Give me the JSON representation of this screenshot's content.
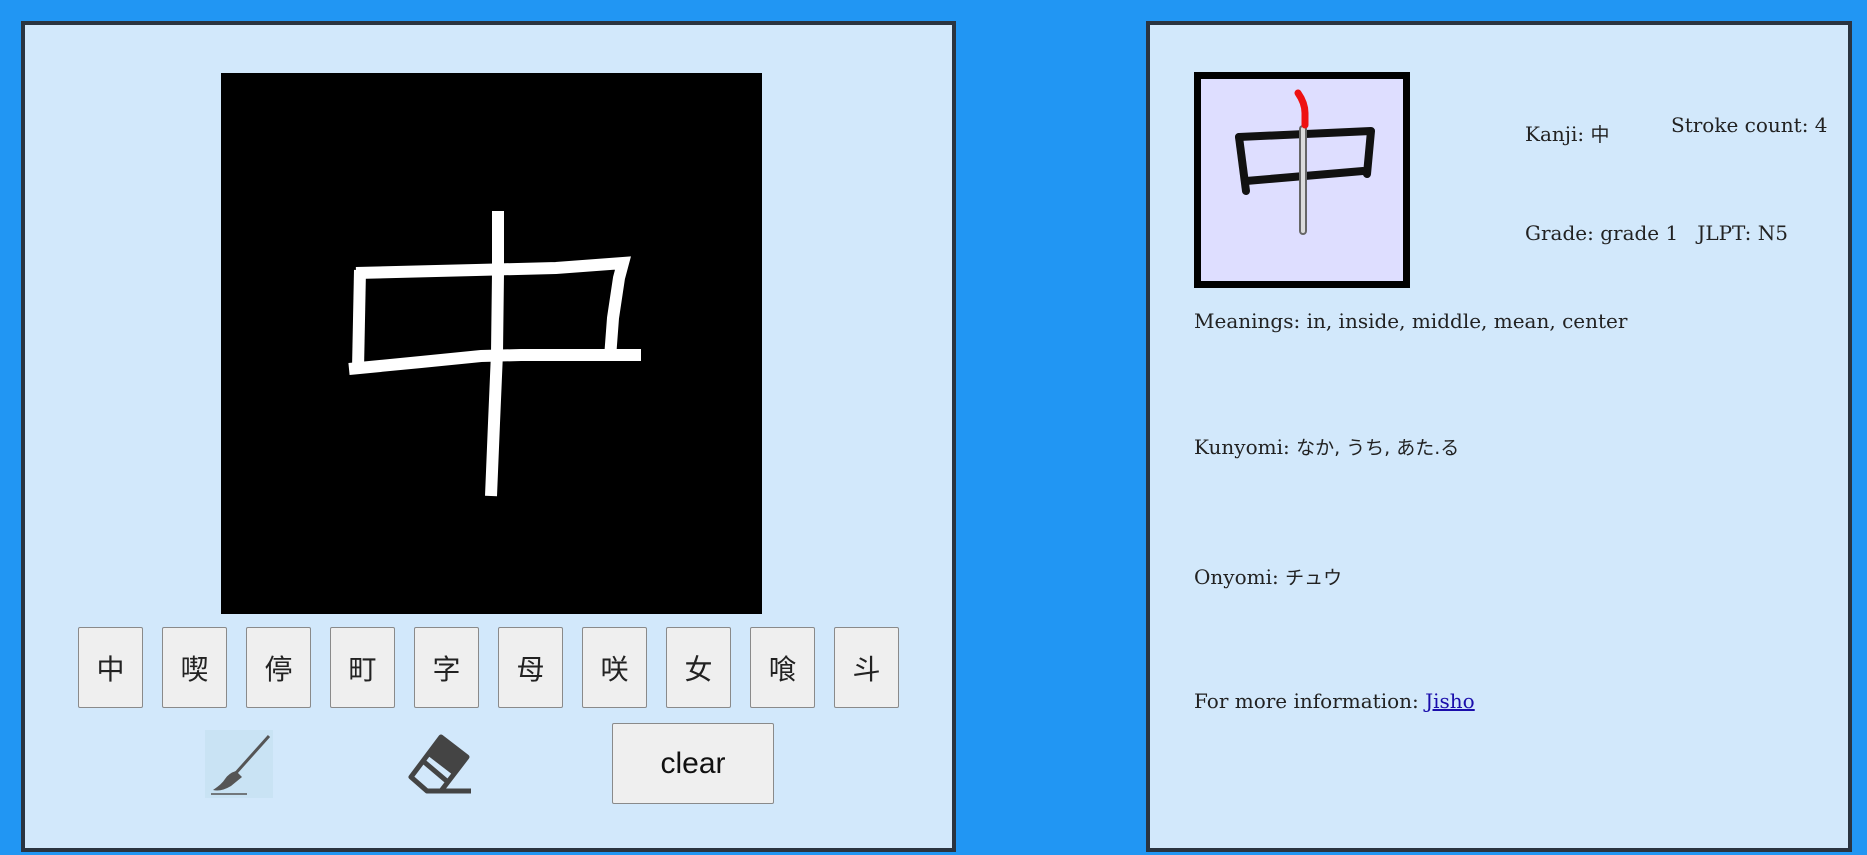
{
  "drawing_pad": {
    "candidates": [
      "中",
      "喫",
      "停",
      "町",
      "字",
      "母",
      "咲",
      "女",
      "喰",
      "斗"
    ],
    "tools": {
      "brush_icon": "brush-icon",
      "eraser_icon": "eraser-icon"
    },
    "clear_label": "clear"
  },
  "kanji_info": {
    "kanji_label": "Kanji: ",
    "kanji_value": "中",
    "stroke_count_label": "Stroke count: ",
    "stroke_count_value": "4",
    "grade_label": "Grade: ",
    "grade_value": "grade 1",
    "jlpt_label": "JLPT: ",
    "jlpt_value": "N5",
    "meanings_label": "Meanings: ",
    "meanings_value": "in, inside, middle, mean, center",
    "kunyomi_label": "Kunyomi: ",
    "kunyomi_value": "なか, うち, あた.る",
    "onyomi_label": "Onyomi: ",
    "onyomi_value": "チュウ",
    "more_info_label": "For more information: ",
    "more_info_link": "Jisho"
  },
  "colors": {
    "background": "#2196f3",
    "panel": "#d2e8fb",
    "current_stroke": "#ee1111"
  }
}
